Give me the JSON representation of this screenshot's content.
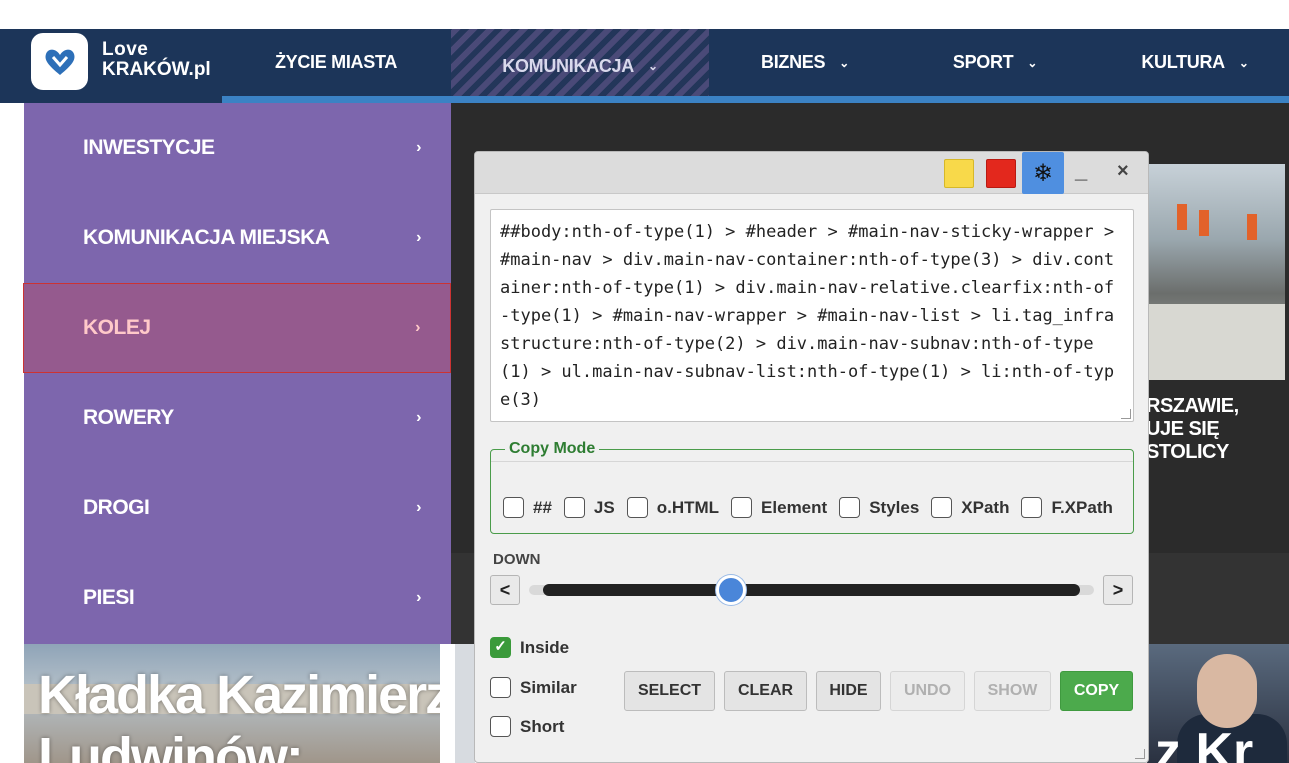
{
  "header": {
    "logo_line1": "Love",
    "logo_line2": "KRAKÓW.pl",
    "nav": [
      {
        "label": "ŻYCIE MIASTA"
      },
      {
        "label": "KOMUNIKACJA",
        "chevron": "⌄"
      },
      {
        "label": "BIZNES",
        "chevron": "⌄"
      },
      {
        "label": "SPORT",
        "chevron": "⌄"
      },
      {
        "label": "KULTURA",
        "chevron": "⌄"
      }
    ]
  },
  "submenu": {
    "items": [
      {
        "label": "INWESTYCJE",
        "arrow": "›"
      },
      {
        "label": "KOMUNIKACJA MIEJSKA",
        "arrow": "›"
      },
      {
        "label": "KOLEJ",
        "arrow": "›"
      },
      {
        "label": "ROWERY",
        "arrow": "›"
      },
      {
        "label": "DROGI",
        "arrow": "›"
      },
      {
        "label": "PIESI",
        "arrow": "›"
      }
    ]
  },
  "content": {
    "headline_right": [
      "RSZAWIE,",
      "UJE SIĘ",
      "STOLICY"
    ],
    "big_title": "Kładka Kazimierz-",
    "big_title_line2": "Ludwinów:",
    "bottom_right_text": "z Kr"
  },
  "dialog": {
    "titlebar": {
      "freeze_icon": "❄",
      "minimize_label": "_",
      "close_label": "×"
    },
    "selector_text": "##body:nth-of-type(1) > #header > #main-nav-sticky-wrapper > #main-nav > div.main-nav-container:nth-of-type(3) > div.container:nth-of-type(1) > div.main-nav-relative.clearfix:nth-of-type(1) > #main-nav-wrapper > #main-nav-list > li.tag_infrastructure:nth-of-type(2) > div.main-nav-subnav:nth-of-type(1) > ul.main-nav-subnav-list:nth-of-type(1) > li:nth-of-type(3)",
    "copy_mode": {
      "legend": "Copy Mode",
      "options": [
        {
          "label": "##",
          "checked": false
        },
        {
          "label": "JS",
          "checked": false
        },
        {
          "label": "o.HTML",
          "checked": false
        },
        {
          "label": "Element",
          "checked": false
        },
        {
          "label": "Styles",
          "checked": false
        },
        {
          "label": "XPath",
          "checked": false
        },
        {
          "label": "F.XPath",
          "checked": false
        }
      ]
    },
    "slider": {
      "label": "DOWN",
      "prev_label": "<",
      "next_label": ">",
      "position": 0.35
    },
    "options": [
      {
        "label": "Inside",
        "checked": true
      },
      {
        "label": "Similar",
        "checked": false
      },
      {
        "label": "Short",
        "checked": false
      }
    ],
    "buttons": [
      {
        "label": "SELECT",
        "state": "normal"
      },
      {
        "label": "CLEAR",
        "state": "normal"
      },
      {
        "label": "HIDE",
        "state": "normal"
      },
      {
        "label": "UNDO",
        "state": "disabled"
      },
      {
        "label": "SHOW",
        "state": "disabled"
      },
      {
        "label": "COPY",
        "state": "primary"
      }
    ],
    "colors": {
      "copy_green": "#4caa4c",
      "yellow": "#f8d94a",
      "red": "#e3281d",
      "freeze_blue": "#4f8fe0"
    }
  }
}
